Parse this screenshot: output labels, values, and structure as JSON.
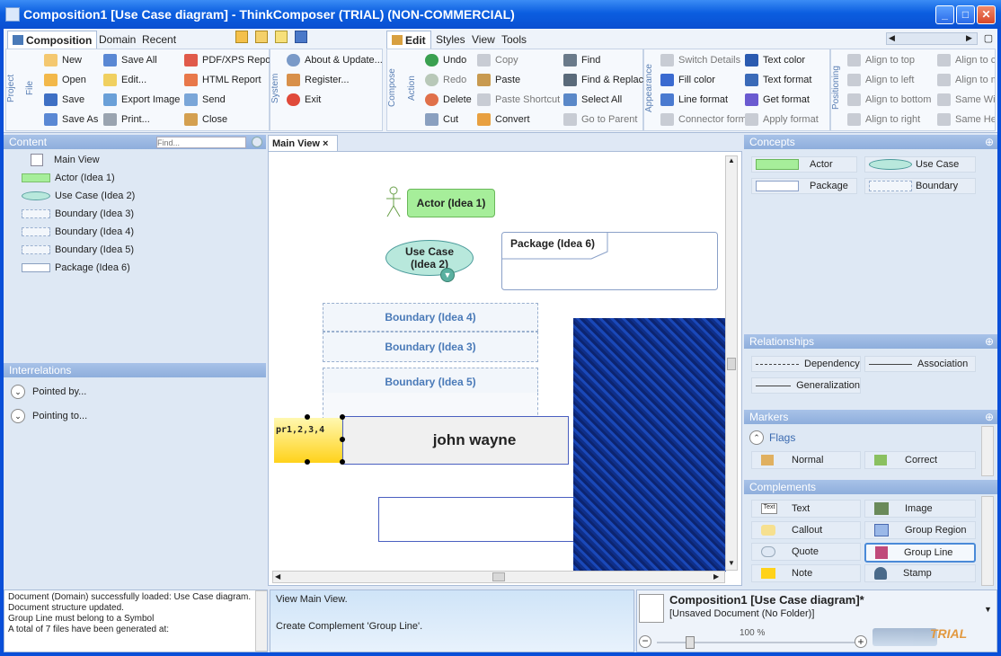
{
  "window": {
    "title": "Composition1 [Use Case diagram] - ThinkComposer (TRIAL) (NON-COMMERCIAL)"
  },
  "ribbon_left": {
    "tabs": [
      "Composition",
      "Domain",
      "Recent"
    ],
    "groups": {
      "project": "Project",
      "file": "File",
      "system": "System"
    },
    "file_col1": [
      "New",
      "Open",
      "Save",
      "Save As"
    ],
    "file_col2": [
      "Save All",
      "Edit...",
      "Export Image",
      "Print..."
    ],
    "file_col3": [
      "PDF/XPS Report",
      "HTML Report",
      "Send",
      "Close"
    ],
    "system_items": [
      "About & Update...",
      "Register...",
      "Exit"
    ]
  },
  "ribbon_right": {
    "tabs": [
      "Edit",
      "Styles",
      "View",
      "Tools"
    ],
    "groups": {
      "compose": "Compose",
      "action": "Action",
      "appearance": "Appearance",
      "positioning": "Positioning"
    },
    "action_col1": [
      "Undo",
      "Redo",
      "Delete",
      "Cut"
    ],
    "action_col2": [
      "Copy",
      "Paste",
      "Paste Shortcut",
      "Convert"
    ],
    "action_col3": [
      "Find",
      "Find & Replace",
      "Select All",
      "Go to Parent"
    ],
    "appearance_col1": [
      "Switch Details",
      "Fill color",
      "Line format",
      "Connector format"
    ],
    "appearance_col2": [
      "Text color",
      "Text format",
      "Get format",
      "Apply format"
    ],
    "positioning_col1": [
      "Align to top",
      "Align to left",
      "Align to bottom",
      "Align to right"
    ],
    "positioning_col2": [
      "Align to ce",
      "Align to m",
      "Same Wid",
      "Same Heig"
    ]
  },
  "content": {
    "title": "Content",
    "find_placeholder": "Find...",
    "items": [
      "Main View",
      "Actor (Idea 1)",
      "Use Case (Idea 2)",
      "Boundary (Idea 3)",
      "Boundary (Idea 4)",
      "Boundary (Idea 5)",
      "Package (Idea 6)"
    ]
  },
  "interrelations": {
    "title": "Interrelations",
    "items": [
      "Pointed by...",
      "Pointing to..."
    ]
  },
  "doc_tab": {
    "label": "Main View",
    "close": "×"
  },
  "diagram": {
    "actor": "Actor (Idea 1)",
    "usecase_line1": "Use Case",
    "usecase_line2": "(Idea 2)",
    "package": "Package (Idea 6)",
    "boundary4": "Boundary (Idea 4)",
    "boundary3": "Boundary (Idea 3)",
    "boundary5": "Boundary (Idea 5)",
    "note_text": "pr1,2,3,4",
    "john": "john wayne"
  },
  "concepts": {
    "title": "Concepts",
    "items": [
      "Actor",
      "Use Case",
      "Package",
      "Boundary"
    ]
  },
  "relationships": {
    "title": "Relationships",
    "items": [
      "Dependency",
      "Association",
      "Generalization"
    ]
  },
  "markers": {
    "title": "Markers",
    "group": "Flags",
    "items": [
      "Normal",
      "Correct"
    ]
  },
  "complements": {
    "title": "Complements",
    "items": [
      "Text",
      "Image",
      "Callout",
      "Group Region",
      "Quote",
      "Group Line",
      "Note",
      "Stamp"
    ],
    "text_icon": "Text"
  },
  "log": {
    "lines": [
      "Document (Domain) successfully loaded: Use Case diagram. Pa",
      "Document structure updated.",
      "Group Line must belong to a Symbol",
      "A total of 7 files have been generated at:"
    ]
  },
  "status": {
    "line1": "View Main View.",
    "line2": "Create Complement 'Group Line'."
  },
  "docinfo": {
    "title": "Composition1 [Use Case diagram]*",
    "subtitle": "[Unsaved Document (No Folder)]"
  },
  "zoom": {
    "label": "100 %",
    "minus": "−",
    "plus": "+"
  },
  "branding": {
    "trial": "TRIAL"
  },
  "colors": {
    "titlebar": "#0a4fd8",
    "pane_header": "#8eaedc",
    "actor_fill": "#a6ee9a",
    "note_fill": "#ffd21a",
    "canvas_border": "#4a5fc0"
  }
}
